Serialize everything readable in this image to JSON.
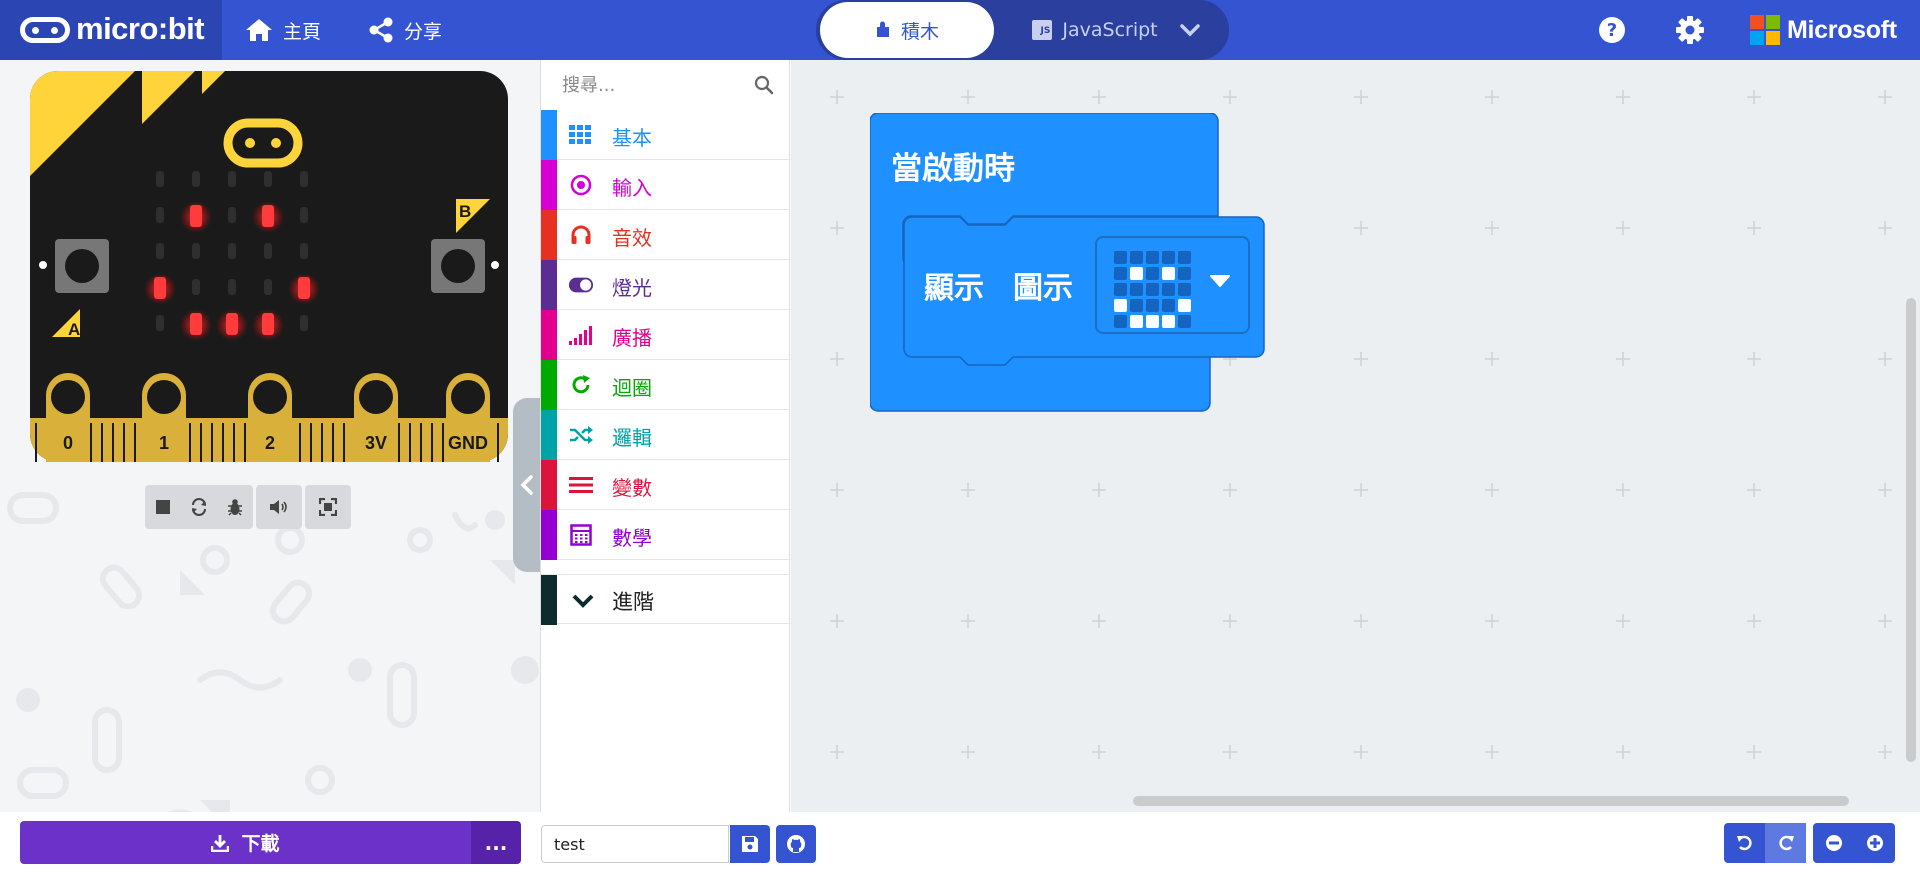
{
  "header": {
    "logo_text": "micro:bit",
    "home_label": "主頁",
    "share_label": "分享",
    "blocks_tab_label": "積木",
    "js_tab_label": "JavaScript",
    "js_badge": "JS",
    "brand_text": "Microsoft",
    "colors": {
      "header_bg": "#3454D1",
      "logo_bg": "#2B45B3"
    }
  },
  "simulator": {
    "pin_labels": [
      "0",
      "1",
      "2",
      "3V",
      "GND"
    ],
    "button_a_label": "A",
    "button_b_label": "B",
    "led_matrix": [
      [
        0,
        0,
        0,
        0,
        0
      ],
      [
        0,
        1,
        0,
        1,
        0
      ],
      [
        0,
        0,
        0,
        0,
        0
      ],
      [
        1,
        0,
        0,
        0,
        1
      ],
      [
        0,
        1,
        1,
        1,
        0
      ]
    ],
    "controls": [
      {
        "name": "stop-icon"
      },
      {
        "name": "restart-icon"
      },
      {
        "name": "debug-icon"
      },
      {
        "name": "mute-icon"
      },
      {
        "name": "fullscreen-icon"
      }
    ]
  },
  "toolbox": {
    "search_placeholder": "搜尋...",
    "categories": [
      {
        "label": "基本",
        "color": "#1E90FF",
        "icon": "grid-icon"
      },
      {
        "label": "輸入",
        "color": "#D400D4",
        "icon": "input-icon"
      },
      {
        "label": "音效",
        "color": "#E63022",
        "icon": "headphones-icon"
      },
      {
        "label": "燈光",
        "color": "#5C2D91",
        "icon": "toggle-icon"
      },
      {
        "label": "廣播",
        "color": "#E3008C",
        "icon": "signal-icon"
      },
      {
        "label": "迴圈",
        "color": "#00AA00",
        "icon": "loop-icon"
      },
      {
        "label": "邏輯",
        "color": "#00A4A6",
        "icon": "shuffle-icon"
      },
      {
        "label": "變數",
        "color": "#DC143C",
        "icon": "variables-icon"
      },
      {
        "label": "數學",
        "color": "#9400D3",
        "icon": "calculator-icon"
      }
    ],
    "advanced_label": "進階"
  },
  "workspace": {
    "on_start_label": "當啟動時",
    "show_label": "顯示",
    "icon_label": "圖示",
    "icon_pattern": [
      [
        0,
        0,
        0,
        0,
        0
      ],
      [
        0,
        1,
        0,
        1,
        0
      ],
      [
        0,
        0,
        0,
        0,
        0
      ],
      [
        1,
        0,
        0,
        0,
        1
      ],
      [
        0,
        1,
        1,
        1,
        0
      ]
    ]
  },
  "bottom": {
    "download_label": "下載",
    "more_label": "...",
    "project_name": "test"
  }
}
